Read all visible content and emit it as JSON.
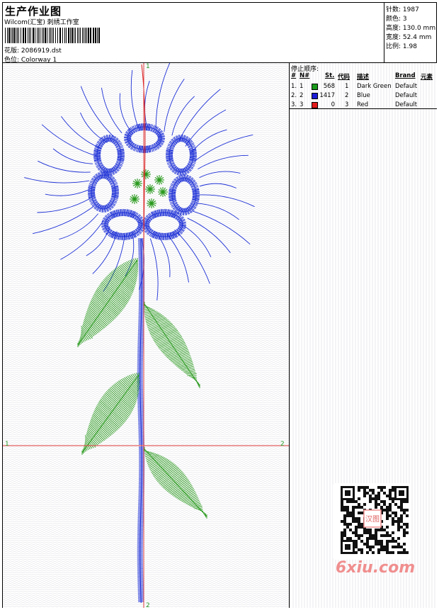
{
  "header": {
    "title": "生产作业图",
    "studio": "Wilcom(汇宝) 刺绣工作室",
    "design_label": "花版:",
    "design_value": "2086919.dst",
    "colorway_label": "色位:",
    "colorway_value": "Colorway 1"
  },
  "stats": {
    "stitches_label": "针数:",
    "stitches_value": "1987",
    "colors_label": "颜色:",
    "colors_value": "3",
    "height_label": "高度:",
    "height_value": "130.0 mm",
    "width_label": "宽度:",
    "width_value": "52.4 mm",
    "scale_label": "比例:",
    "scale_value": "1.98"
  },
  "design": {
    "axis_labels": {
      "v_top": "1",
      "v_bottom": "2",
      "h_left": "1",
      "h_right": "2"
    }
  },
  "stop_sequence": {
    "title": "停止顺序:",
    "headers": [
      "#",
      "N#",
      "St.",
      "代码",
      "描述",
      "Brand",
      "元素"
    ],
    "rows": [
      {
        "idx": "1.",
        "n": "1",
        "st": "568",
        "code": "1",
        "desc": "Dark Green",
        "brand": "Default",
        "color": "#1a9a1a"
      },
      {
        "idx": "2.",
        "n": "2",
        "st": "1417",
        "code": "2",
        "desc": "Blue",
        "brand": "Default",
        "color": "#1c1cd6"
      },
      {
        "idx": "3.",
        "n": "3",
        "st": "0",
        "code": "3",
        "desc": "Red",
        "brand": "Default",
        "color": "#e21a1a"
      }
    ]
  },
  "watermark": {
    "text": "6xiu.com",
    "qr_label": "汉图"
  },
  "colors": {
    "green": "#2a9a1e",
    "blue": "#1c2fd6",
    "red": "#d81a1a",
    "axis": "#e03c3c",
    "watermark": "#f08e8e"
  }
}
